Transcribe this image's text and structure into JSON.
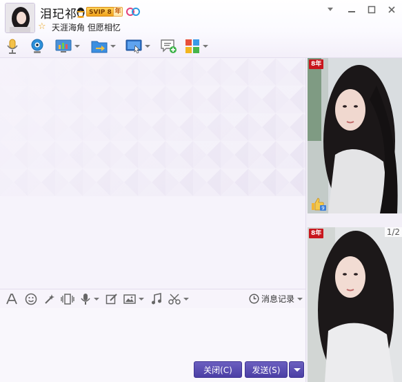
{
  "contact": {
    "name": "泪玘祁",
    "vip_label": "SVIP 8",
    "year_label": "年",
    "signature": "天涯海角 但愿相忆"
  },
  "window_controls": [
    "▾",
    "—",
    "☐",
    "✕"
  ],
  "toolbar": {
    "items": [
      "voice-call-icon",
      "video-call-icon",
      "screen-share-icon",
      "file-transfer-icon",
      "remote-desktop-icon",
      "new-discussion-icon",
      "app-grid-icon"
    ]
  },
  "input_toolbar": {
    "items": [
      "font-icon",
      "emoji-icon",
      "magic-wand-icon",
      "shake-icon",
      "voice-message-icon",
      "edit-icon",
      "image-icon",
      "music-icon",
      "screenshot-icon"
    ],
    "history_label": "消息记录"
  },
  "buttons": {
    "close_label": "关闭(C)",
    "send_label": "发送(S)"
  },
  "side_panel": {
    "ribbon_1": "8年",
    "ribbon_2": "8年",
    "like_count": "9",
    "page_indicator": "1/2"
  },
  "colors": {
    "accent": "#4b3fa5",
    "background": "#f6f3fb",
    "vip_gold": "#f0a21c"
  }
}
